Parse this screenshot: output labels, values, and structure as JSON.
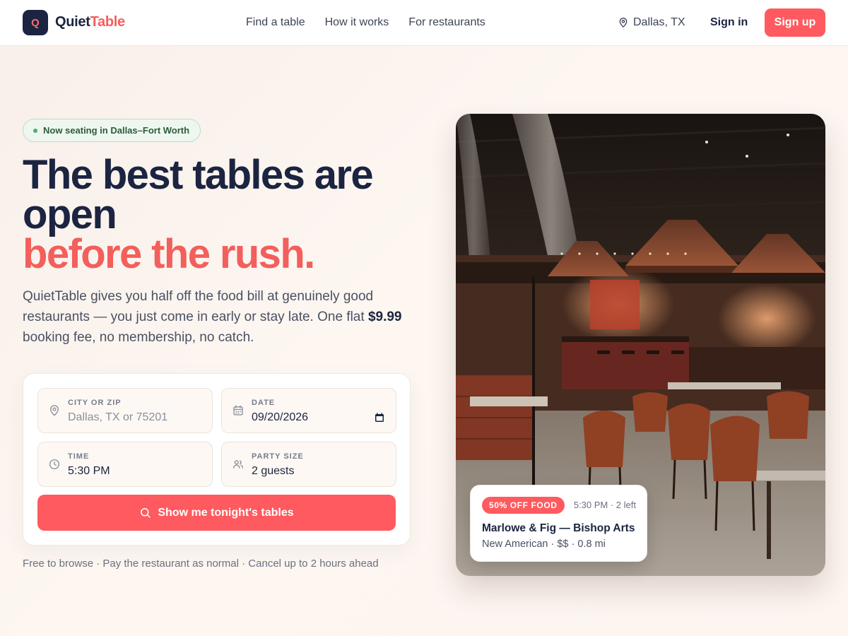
{
  "nav": {
    "logo_letter": "Q",
    "brand_part1": "Quiet",
    "brand_part2": "Table",
    "links": [
      "Find a table",
      "How it works",
      "For restaurants"
    ],
    "location": "Dallas, TX",
    "signin_label": "Sign in",
    "signup_label": "Sign up"
  },
  "hero": {
    "badge": "Now seating in Dallas–Fort Worth",
    "headline_line1": "The best tables are open",
    "headline_accent": "before the rush.",
    "lead_before": "QuietTable gives you half off the food bill at genuinely good restaurants — you just come in early or stay late. One flat ",
    "lead_price": "$9.99",
    "lead_after": " booking fee, no membership, no catch."
  },
  "search": {
    "city": {
      "label": "CITY OR ZIP",
      "value": "",
      "placeholder": "Dallas, TX or 75201"
    },
    "date": {
      "label": "DATE",
      "value": "09/20/2026"
    },
    "time": {
      "label": "TIME",
      "value": "5:30 PM"
    },
    "party": {
      "label": "PARTY SIZE",
      "value": "2 guests"
    },
    "cta_label": "Show me tonight's tables"
  },
  "footnote": "Free to browse · Pay the restaurant as normal · Cancel up to 2 hours ahead",
  "deal": {
    "badge": "50% OFF FOOD",
    "meta": "5:30 PM · 2 left",
    "name": "Marlowe & Fig — Bishop Arts",
    "details": "New American · $$ · 0.8 mi"
  },
  "colors": {
    "accent": "#ff5a5f",
    "navy": "#1b2440",
    "badge_green": "#4caf6d"
  },
  "icons": {
    "location": "map-pin-icon",
    "calendar": "calendar-icon",
    "time": "clock-icon",
    "party": "users-icon",
    "search": "search-icon"
  }
}
